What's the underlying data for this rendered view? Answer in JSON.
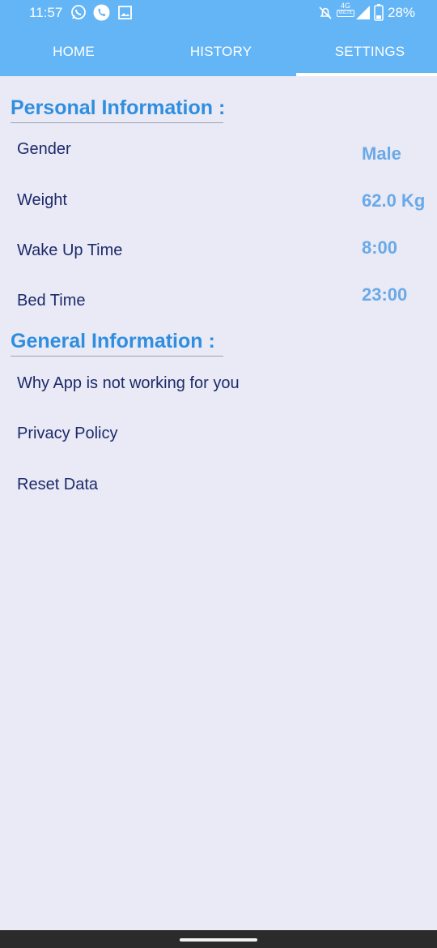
{
  "status_bar": {
    "time": "11:57",
    "network": "4G",
    "network_sub": "VoLTE",
    "battery": "28%"
  },
  "tabs": [
    {
      "label": "HOME",
      "selected": false
    },
    {
      "label": "HISTORY",
      "selected": false
    },
    {
      "label": "SETTINGS",
      "selected": true
    }
  ],
  "personal": {
    "title": "Personal Information :",
    "rows": [
      {
        "label": "Gender",
        "value": "Male"
      },
      {
        "label": "Weight",
        "value": "62.0 Kg"
      },
      {
        "label": "Wake Up Time",
        "value": "8:00"
      },
      {
        "label": "Bed Time",
        "value": "23:00"
      }
    ]
  },
  "general": {
    "title": "General Information :",
    "items": [
      {
        "label": "Why App is not working for you"
      },
      {
        "label": "Privacy Policy"
      },
      {
        "label": "Reset Data"
      }
    ]
  },
  "colors": {
    "header": "#64b5f6",
    "section_title": "#2f8ee0",
    "label": "#1d2a6b",
    "value": "#6aa9e8",
    "background": "#e9eaf5"
  }
}
